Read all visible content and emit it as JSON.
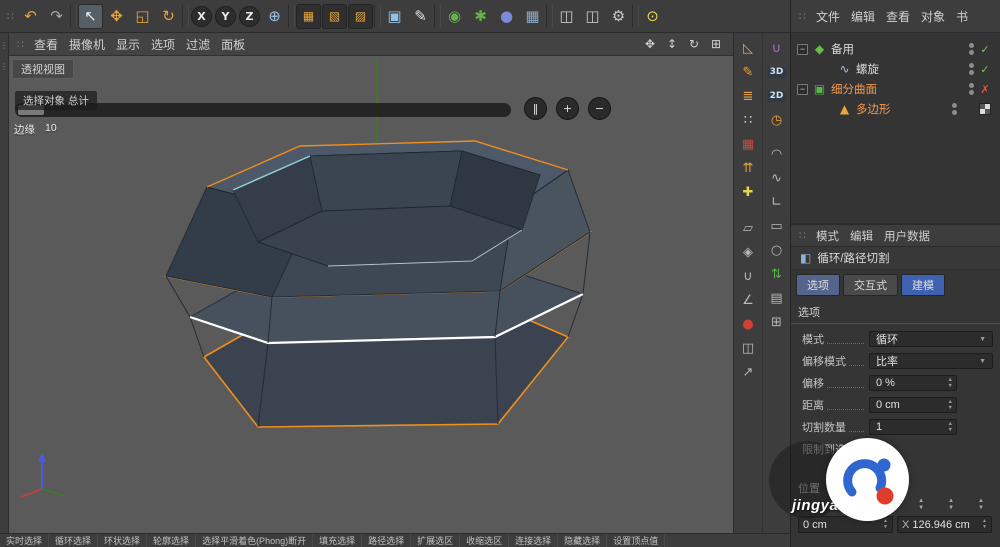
{
  "colors": {
    "accent_orange": "#e8941a",
    "tab_blue": "#3f62b0",
    "edge_orange": "#f08f1c",
    "edge_white": "#ffffff",
    "check_green": "#7ec24a",
    "cross_red": "#e05545",
    "viewport_bg": "#5a5a5a"
  },
  "glyphs": {
    "grip": "∷",
    "dock_grip": "⋮",
    "dropdown_arrow": "▼",
    "spin_up": "▲",
    "spin_down": "▼"
  },
  "top_toolbar": {
    "icons": [
      {
        "name": "undo-icon",
        "glyph": "↶",
        "color": "#e8a33d"
      },
      {
        "name": "redo-icon",
        "glyph": "↷",
        "color": "#a8a8a8"
      },
      {
        "name": "separator",
        "glyph": "",
        "variant": "sep",
        "inter": "false"
      },
      {
        "name": "select-tool-icon",
        "glyph": "↖",
        "color": "#f0f0f0",
        "variant": "active"
      },
      {
        "name": "move-tool-icon",
        "glyph": "✥",
        "color": "#e8a33d"
      },
      {
        "name": "scale-tool-icon",
        "glyph": "◱",
        "color": "#e8a33d"
      },
      {
        "name": "rotate-tool-icon",
        "glyph": "↻",
        "color": "#e8a33d"
      },
      {
        "name": "separator",
        "glyph": "",
        "variant": "sep",
        "inter": "false"
      },
      {
        "name": "x-axis-lock-button",
        "glyph": "X",
        "variant": "circle"
      },
      {
        "name": "y-axis-lock-button",
        "glyph": "Y",
        "variant": "circle"
      },
      {
        "name": "z-axis-lock-button",
        "glyph": "Z",
        "variant": "circle"
      },
      {
        "name": "coordinate-system-icon",
        "glyph": "⊕",
        "color": "#9fc3e8"
      },
      {
        "name": "separator",
        "glyph": "",
        "variant": "sep",
        "inter": "false"
      },
      {
        "name": "modeling-mode-icon-1",
        "glyph": "▦",
        "color": "#e8a33d",
        "variant": "chip"
      },
      {
        "name": "modeling-mode-icon-2",
        "glyph": "▧",
        "color": "#e8a33d",
        "variant": "chip"
      },
      {
        "name": "modeling-mode-icon-3",
        "glyph": "▨",
        "color": "#e8a33d",
        "variant": "chip"
      },
      {
        "name": "separator",
        "glyph": "",
        "variant": "sep",
        "inter": "false"
      },
      {
        "name": "make-editable-cube-icon",
        "glyph": "▣",
        "color": "#8fc1e8"
      },
      {
        "name": "pen-tool-icon",
        "glyph": "✎",
        "color": "#e0e0e0"
      },
      {
        "name": "separator",
        "glyph": "",
        "variant": "sep",
        "inter": "false"
      },
      {
        "name": "simulation-sphere-icon",
        "glyph": "◉",
        "color": "#67b04a"
      },
      {
        "name": "field-icon",
        "glyph": "✱",
        "color": "#67b04a"
      },
      {
        "name": "volume-icon",
        "glyph": "●",
        "color": "#7c89d8"
      },
      {
        "name": "array-icon",
        "glyph": "▦",
        "color": "#8fa8c8"
      },
      {
        "name": "separator",
        "glyph": "",
        "variant": "sep",
        "inter": "false"
      },
      {
        "name": "render-view-icon",
        "glyph": "◫",
        "color": "#c8c8c8"
      },
      {
        "name": "render-picture-viewer-icon",
        "glyph": "◫",
        "color": "#c8c8c8"
      },
      {
        "name": "render-settings-icon",
        "glyph": "⚙",
        "color": "#c8c8c8"
      },
      {
        "name": "separator",
        "glyph": "",
        "variant": "sep",
        "inter": "false"
      },
      {
        "name": "light-icon",
        "glyph": "⊙",
        "color": "#e8d44a"
      }
    ]
  },
  "panel_menu": {
    "items": [
      "文件",
      "编辑",
      "查看",
      "对象",
      "书"
    ]
  },
  "viewport_menu": {
    "items": [
      "查看",
      "摄像机",
      "显示",
      "选项",
      "过滤",
      "面板"
    ],
    "nav": [
      {
        "name": "pan-view-icon",
        "glyph": "✥"
      },
      {
        "name": "zoom-view-icon",
        "glyph": "↕"
      },
      {
        "name": "rotate-view-icon",
        "glyph": "↻"
      },
      {
        "name": "layout-view-icon",
        "glyph": "⊞"
      }
    ]
  },
  "viewport": {
    "tab_label": "透视视图",
    "hud": {
      "info_label": "选择对象 总计",
      "buttons": [
        {
          "name": "pause-button",
          "glyph": "‖"
        },
        {
          "name": "plus-button",
          "glyph": "+"
        },
        {
          "name": "minus-button",
          "glyph": "−"
        }
      ],
      "edge_label": "边缘",
      "edge_value": "10"
    }
  },
  "left_strip": {
    "icons": [
      {
        "name": "dock-grip-top",
        "glyph": "⋮"
      },
      {
        "name": "dock-grip-bottom",
        "glyph": "⋮"
      }
    ]
  },
  "col1": {
    "icons": [
      {
        "name": "measure-icon",
        "glyph": "◺",
        "color": "#e8a33d"
      },
      {
        "name": "brush-icon",
        "glyph": "✎",
        "color": "#e8a33d"
      },
      {
        "name": "layer-stack-icon",
        "glyph": "≣",
        "color": "#e8a33d"
      },
      {
        "name": "point-grid-icon",
        "glyph": "∷",
        "color": "#d8d8d8"
      },
      {
        "name": "grid-delete-icon",
        "glyph": "▦",
        "color": "#d0483c"
      },
      {
        "name": "extrude-icon",
        "glyph": "⇈",
        "color": "#e8a33d"
      },
      {
        "name": "axis-xyz-icon",
        "glyph": "✚",
        "color": "#e8d44a"
      },
      {
        "name": "plane-icon",
        "glyph": "▱",
        "color": "#b8b8b8"
      },
      {
        "name": "workplane-icon",
        "glyph": "◈",
        "color": "#b8b8b8"
      },
      {
        "name": "snap-icon",
        "glyph": "∪",
        "color": "#b8b8b8"
      },
      {
        "name": "guide-icon",
        "glyph": "∠",
        "color": "#b8b8b8"
      },
      {
        "name": "pin-icon",
        "glyph": "●",
        "color": "#d04038"
      },
      {
        "name": "mirror-icon",
        "glyph": "◫",
        "color": "#b8b8b8"
      },
      {
        "name": "arrange-icon",
        "glyph": "↗",
        "color": "#b8b8b8"
      }
    ]
  },
  "col2": {
    "icons": [
      {
        "name": "magnet-icon",
        "glyph": "∪",
        "color": "#b06ad8"
      },
      {
        "name": "3d-snap-badge",
        "glyph": "3D",
        "variant": "badge"
      },
      {
        "name": "2d-snap-badge",
        "glyph": "2D",
        "variant": "badge"
      },
      {
        "name": "timer-icon",
        "glyph": "◷",
        "color": "#e8a33d"
      },
      {
        "name": "arc-icon",
        "glyph": "◠",
        "color": "#b8b8b8"
      },
      {
        "name": "spline-icon",
        "glyph": "∿",
        "color": "#b8b8b8"
      },
      {
        "name": "corner-icon",
        "glyph": "∟",
        "color": "#b8b8b8"
      },
      {
        "name": "rect-icon",
        "glyph": "▭",
        "color": "#b8b8b8"
      },
      {
        "name": "circle-icon",
        "glyph": "○",
        "color": "#b8b8b8"
      },
      {
        "name": "swap-arrows-icon",
        "glyph": "⇅",
        "color": "#5ab04a"
      },
      {
        "name": "doc-icon",
        "glyph": "▤",
        "color": "#b8b8b8"
      },
      {
        "name": "grid-icon",
        "glyph": "⊞",
        "color": "#b8b8b8"
      }
    ]
  },
  "object_manager": {
    "items": [
      {
        "indent": 0,
        "expand": "−",
        "icon_glyph": "◆",
        "icon_color": "#6cbf44",
        "label": "备用",
        "label_color": "#dadada",
        "mark": "✓",
        "mark_color": "#7ec24a",
        "tag": ""
      },
      {
        "indent": 1,
        "expand": "",
        "icon_glyph": "∿",
        "icon_color": "#a8c0e8",
        "label": "螺旋",
        "label_color": "#dadada",
        "mark": "✓",
        "mark_color": "#7ec24a",
        "tag": ""
      },
      {
        "indent": 0,
        "expand": "−",
        "icon_glyph": "▣",
        "icon_color": "#57b847",
        "label": "细分曲面",
        "label_color": "#f09a50",
        "mark": "✗",
        "mark_color": "#e05545",
        "tag": ""
      },
      {
        "indent": 1,
        "expand": "",
        "icon_glyph": "▲",
        "icon_color": "#e8a33d",
        "label": "多边形",
        "label_color": "#f09a50",
        "mark": "",
        "mark_color": "",
        "tag": "checker"
      }
    ]
  },
  "attributes": {
    "menu": [
      "模式",
      "编辑",
      "用户数据"
    ],
    "tool_icon_glyph": "◧",
    "tool_name": "循环/路径切割",
    "tabs": [
      {
        "label": "选项",
        "variant": "active"
      },
      {
        "label": "交互式",
        "variant": "plain"
      },
      {
        "label": "建模",
        "variant": "selected"
      }
    ],
    "section_title": "选项",
    "rows": [
      {
        "label": "模式",
        "variant": "dropdown",
        "value": "循环"
      },
      {
        "label": "偏移模式",
        "variant": "dropdown",
        "value": "比率"
      },
      {
        "label": "偏移",
        "variant": "number",
        "value": "0 %"
      },
      {
        "label": "距离",
        "variant": "number",
        "value": "0 cm"
      },
      {
        "label": "切割数量",
        "variant": "number",
        "value": "1"
      },
      {
        "label": "限制到选择",
        "variant": "checkbox",
        "value": ""
      }
    ]
  },
  "coords": {
    "title": "位置",
    "field1_value": "0 cm",
    "axis_label": "X",
    "field2_value": "126.946 cm"
  },
  "bottom_bar": {
    "items": [
      "实时选择",
      "循环选择",
      "环状选择",
      "轮廓选择",
      "选择平滑着色(Phong)断开",
      "填充选择",
      "路径选择",
      "扩展选区",
      "收缩选区",
      "连接选择",
      "隐藏选择",
      "设置顶点值"
    ]
  },
  "watermark": {
    "text": "jingyan.ba"
  }
}
